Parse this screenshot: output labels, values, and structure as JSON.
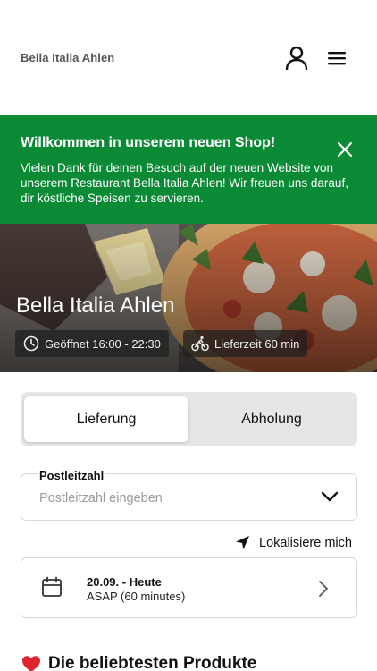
{
  "header": {
    "brand": "Bella Italia Ahlen",
    "icons": {
      "account": "user-icon",
      "menu": "hamburger-menu-icon"
    }
  },
  "banner": {
    "title": "Willkommen in unserem neuen Shop!",
    "text": "Vielen Dank für deinen Besuch auf der neuen Website von unserem Restaurant Bella Italia Ahlen! Wir freuen uns darauf, dir köstliche Speisen zu servieren.",
    "color": "#0b8a35"
  },
  "hero": {
    "title": "Bella Italia Ahlen",
    "opening": "Geöffnet 16:00 - 22:30",
    "delivery_time": "Lieferzeit 60 min"
  },
  "order_mode": {
    "options": [
      "Lieferung",
      "Abholung"
    ],
    "selected": "Lieferung"
  },
  "postcode": {
    "label": "Postleitzahl",
    "placeholder": "Postleitzahl eingeben",
    "value": ""
  },
  "locate": {
    "label": "Lokalisiere mich"
  },
  "schedule": {
    "date": "20.09. - Heute",
    "time": "ASAP (60 minutes)"
  },
  "popular": {
    "title": "Die beliebtesten Produkte",
    "icon": "heart-icon",
    "icon_color": "#e0242b"
  }
}
